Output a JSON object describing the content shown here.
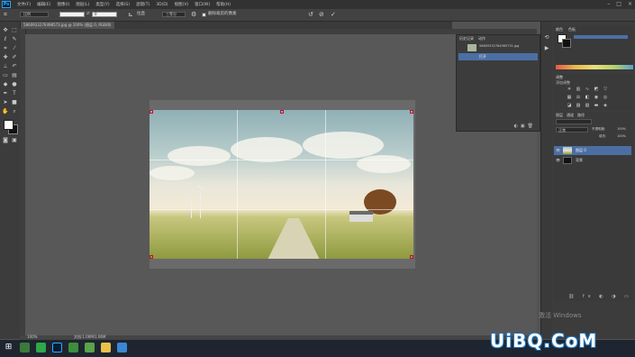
{
  "app": {
    "logo": "Ps"
  },
  "menubar": {
    "items": [
      "文件(F)",
      "编辑(E)",
      "图像(I)",
      "图层(L)",
      "类型(Y)",
      "选择(S)",
      "滤镜(T)",
      "3D(D)",
      "视图(V)",
      "窗口(W)",
      "帮助(H)"
    ],
    "controls": [
      "–",
      "□",
      "×"
    ]
  },
  "options": {
    "preset": "比例",
    "ratio_value": "0",
    "label_straighten": "拉直",
    "view": "三等分",
    "delete_cropped": "删除裁剪的像素"
  },
  "document": {
    "tab_title": "5860933276498573.jpg @ 100% (图层 0, RGB/8)"
  },
  "history": {
    "tabs": [
      "历史记录",
      "动作"
    ],
    "snapshot": "58609332764985731.jpg",
    "step": "打开"
  },
  "panels": {
    "color_tabs": [
      "颜色",
      "色板"
    ],
    "adjust_title": "调整",
    "adjust_caption": "添加调整",
    "layers_tabs": [
      "图层",
      "通道",
      "路径"
    ],
    "blend_mode": "正常",
    "opacity_label": "不透明度:",
    "opacity_value": "100%",
    "fill_label": "填充:",
    "fill_value": "100%",
    "layers": [
      {
        "name": "图层 0",
        "selected": true
      },
      {
        "name": "背景",
        "selected": false
      }
    ]
  },
  "status": {
    "zoom": "100%",
    "doc_info": "文档:1.06M/1.06M"
  },
  "watermark": {
    "windows": "激活 Windows",
    "brand": "UiBQ.CoM"
  },
  "colors": {
    "accent": "#4b6fa3",
    "crop_handle": "#c8102e",
    "foreground": "#ffffff",
    "background": "#111111"
  },
  "tool_icons": [
    "move-icon",
    "marquee-icon",
    "lasso-icon",
    "quick-select-icon",
    "crop-icon",
    "eyedropper-icon",
    "healing-icon",
    "brush-icon",
    "stamp-icon",
    "history-brush-icon",
    "eraser-icon",
    "gradient-icon",
    "blur-icon",
    "dodge-icon",
    "pen-icon",
    "type-icon",
    "path-select-icon",
    "shape-icon",
    "hand-icon",
    "zoom-icon"
  ]
}
